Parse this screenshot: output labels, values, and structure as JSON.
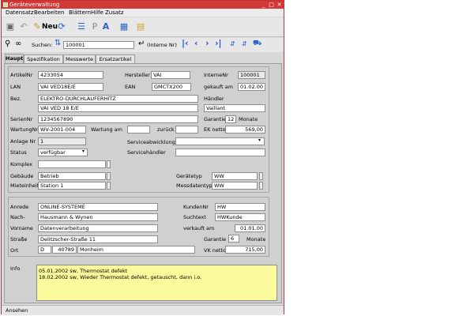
{
  "title": "Geräteverwaltung",
  "menu": [
    "Datensatz",
    "Bearbeiten",
    "Blättern",
    "Hilfe",
    "Zusatz"
  ],
  "toolbar": {
    "neu_label": "Neu"
  },
  "search": {
    "label": "Suchen:",
    "value": "100001",
    "hint": "(Interne Nr)"
  },
  "tabs": [
    "Haupt",
    "Spezifikation",
    "Messwerte",
    "Ersatzartikel"
  ],
  "labels": {
    "artikelnr": "ArtikelNr",
    "hersteller": "Hersteller",
    "internenr": "InterneNr",
    "lan": "LAN",
    "ean": "EAN",
    "gekauft_am": "gekauft am",
    "bez": "Bez.",
    "haendler": "Händler",
    "seriennr": "SerienNr",
    "garantie": "Garantie",
    "monate": "Monate",
    "wartungnr": "WartungNr",
    "wartung_am": "Wartung am",
    "zurueck": "zurück",
    "ek_netto": "EK netto",
    "anlage_nr": "Anlage Nr",
    "serviceabwicklung": "Serviceabwicklung",
    "status": "Status",
    "servicehaendler": "Servicehändler",
    "komplex": "Komplex",
    "gebaeude": "Gebäude",
    "geraetetyp": "Gerätetyp",
    "mieteinheit": "Mieteinheit",
    "messdatentyp": "Messdatentyp",
    "anrede": "Anrede",
    "kundennr": "KundenNr",
    "nach": "Nach-",
    "suchtext": "Suchtext",
    "vorname": "Vorname",
    "verkauft_am": "verkauft am",
    "strasse": "Straße",
    "garantie2": "Garantie",
    "monate2": "Monate",
    "ort": "Ort",
    "vk_netto": "VK netto",
    "info": "Info"
  },
  "values": {
    "artikelnr": "4233054",
    "hersteller": "VAI",
    "internenr": "100001",
    "lan": "VAI VED18E/E",
    "ean": "GMCTX200",
    "gekauft_am": "01.02.00",
    "bez1": "ELEKTRO-DURCHLAUFERHITZ",
    "bez2": "VAI VED 18 E/E",
    "haendler": "Vaillant",
    "seriennr": "1234567890",
    "garantie": "12",
    "wartungnr": "WV-2001-004",
    "wartung_am": "",
    "zurueck": "",
    "ek_netto": "569,00",
    "anlage_nr": "1",
    "serviceabwicklung": "",
    "status": "verfügbar",
    "servicehaendler": "",
    "komplex": "",
    "gebaeude": "Betrieb",
    "geraetetyp": "WW",
    "mieteinheit": "Station 1",
    "messdatentyp": "WW",
    "anrede": "ONLINE-SYSTEME",
    "kundennr": "HW",
    "nach": "Hausmann & Wynen",
    "suchtext": "HWKunde",
    "vorname": "Datenverarbeitung",
    "verkauft_am": "01.01.00",
    "strasse": "Delitzscher-Straße 11",
    "garantie2": "6",
    "land": "D",
    "plz": "40789",
    "ort": "Monheim",
    "vk_netto": "715,00"
  },
  "info_lines": [
    "05.01.2002 sw, Thermostat defekt",
    "18.02.2002 sw, Wieder Thermostat defekt, getauscht, dann i.o."
  ],
  "status_text": "Ansehen"
}
